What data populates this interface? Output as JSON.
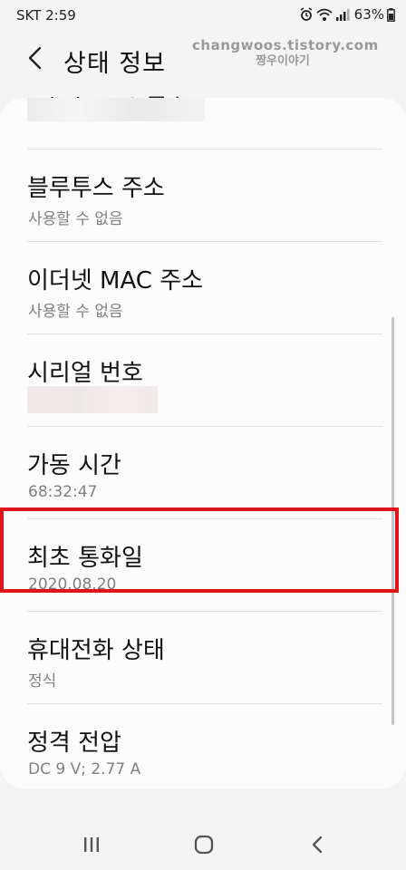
{
  "status_bar": {
    "carrier_time": "SKT  2:59",
    "battery": "63%"
  },
  "header": {
    "back_icon": "chevron-left-icon",
    "title": "상태 정보"
  },
  "watermark": {
    "line1": "changwoos.tistory.com",
    "line2": "짱우이야기"
  },
  "partial_row": {
    "title": "Wi-Fi MAC 주소"
  },
  "rows": [
    {
      "title": "블루투스 주소",
      "value": "사용할 수 없음"
    },
    {
      "title": "이더넷 MAC 주소",
      "value": "사용할 수 없음"
    },
    {
      "title": "시리얼 번호",
      "value": ""
    },
    {
      "title": "가동 시간",
      "value": "68:32:47"
    },
    {
      "title": "최초 통화일",
      "value": "2020.08.20"
    },
    {
      "title": "휴대전화 상태",
      "value": "정식"
    },
    {
      "title": "정격 전압",
      "value": "DC 9 V; 2.77 A"
    }
  ],
  "highlight": {
    "color": "#e1141b"
  },
  "nav_bar": {
    "recent_icon": "recent-apps-icon",
    "home_icon": "home-icon",
    "back_icon": "back-chevron-icon"
  }
}
